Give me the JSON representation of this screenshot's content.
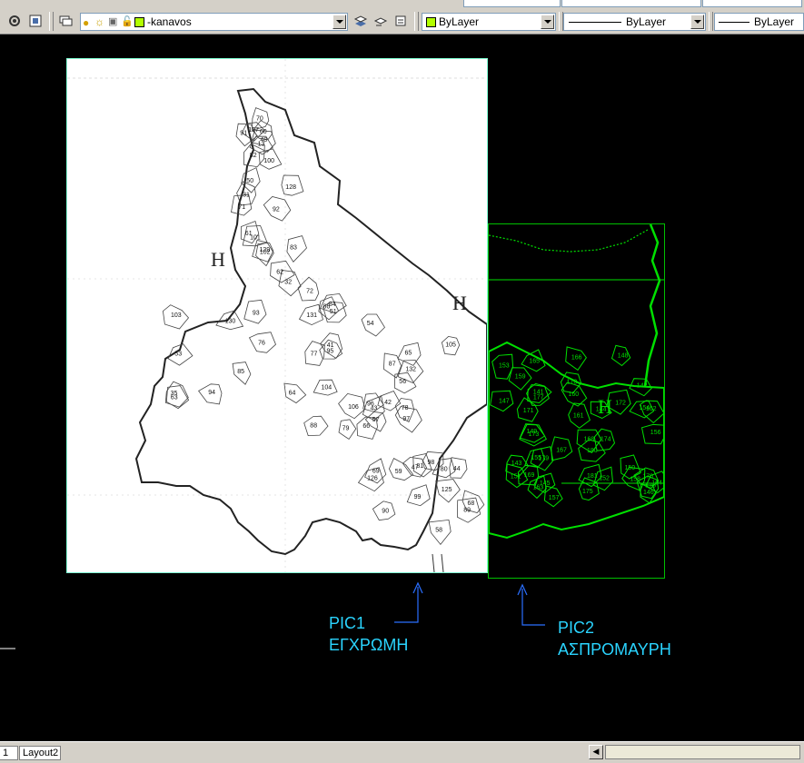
{
  "toolbar": {
    "layer_name": "-kanavos",
    "color_value": "ByLayer",
    "linetype_value": "ByLayer",
    "lineweight_value": "ByLayer"
  },
  "drawing": {
    "pic1_label_line1": "PIC1",
    "pic1_label_line2": "ΕΓΧΡΩΜΗ",
    "pic2_label_line1": "PIC2",
    "pic2_label_line2": "ΑΣΠΡΟΜΑΥΡΗ",
    "map_letter": "Η",
    "pic1_parcel_numbers": [
      "13",
      "31",
      "32",
      "35",
      "41",
      "42",
      "43",
      "44",
      "47",
      "48",
      "50",
      "51",
      "53",
      "54",
      "56",
      "57",
      "58",
      "59",
      "60",
      "61",
      "62",
      "63",
      "64",
      "65",
      "66",
      "68",
      "69",
      "70",
      "71",
      "72",
      "76",
      "77",
      "78",
      "79",
      "80",
      "81",
      "82",
      "83",
      "84",
      "85",
      "86",
      "87",
      "88",
      "89",
      "90",
      "91",
      "92",
      "93",
      "94",
      "95",
      "96",
      "97",
      "98",
      "99",
      "100",
      "101",
      "102",
      "103",
      "104",
      "105",
      "106",
      "125",
      "126",
      "127",
      "128",
      "129",
      "130",
      "131",
      "132"
    ],
    "pic2_parcel_numbers": [
      "141",
      "142",
      "143",
      "144",
      "145",
      "146",
      "147",
      "148",
      "149",
      "150",
      "151",
      "152",
      "153",
      "154",
      "155",
      "156",
      "157",
      "158",
      "159",
      "160",
      "161",
      "162",
      "163",
      "164",
      "165",
      "166",
      "167",
      "168",
      "169",
      "170",
      "171",
      "172",
      "173",
      "174",
      "175",
      "176",
      "177",
      "178",
      "179",
      "180",
      "181"
    ]
  },
  "colors": {
    "canvas_bg": "#000000",
    "pic2_linework": "#00e000",
    "annotation": "#2ad4ff",
    "pic1_frame": "#7fffd4",
    "layer_color": "#b2ff00"
  },
  "status": {
    "tab_model": "1",
    "tab_layout2": "Layout2"
  }
}
